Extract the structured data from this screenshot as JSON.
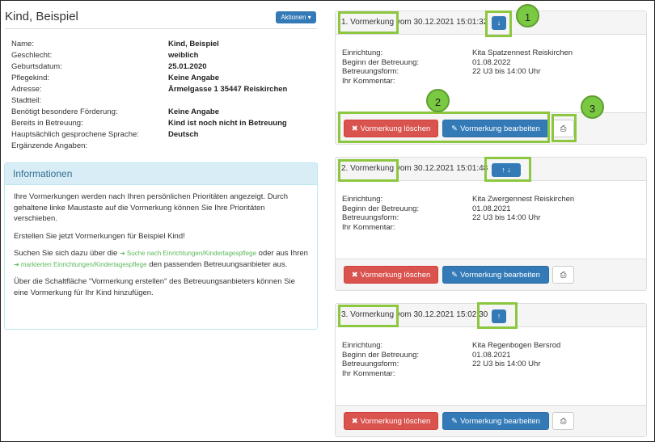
{
  "person": {
    "name": "Kind, Beispiel",
    "actions_label": "Aktionen ▾"
  },
  "details": [
    {
      "label": "Name:",
      "value": "Kind, Beispiel"
    },
    {
      "label": "Geschlecht:",
      "value": "weiblich"
    },
    {
      "label": "Geburtsdatum:",
      "value": "25.01.2020"
    },
    {
      "label": "Pflegekind:",
      "value": "Keine Angabe"
    },
    {
      "label": "Adresse:",
      "value": "Ärmelgasse 1 35447 Reiskirchen"
    },
    {
      "label": "Stadtteil:",
      "value": ""
    },
    {
      "label": "Benötigt besondere Förderung:",
      "value": "Keine Angabe"
    },
    {
      "label": "Bereits in Betreuung:",
      "value": "Kind ist noch nicht in Betreuung"
    },
    {
      "label": "Hauptsächlich gesprochene Sprache:",
      "value": "Deutsch"
    },
    {
      "label": "Ergänzende Angaben:",
      "value": ""
    }
  ],
  "info_panel": {
    "title": "Informationen",
    "p1": "Ihre Vormerkungen werden nach Ihren persönlichen Prioritäten angezeigt. Durch gehaltene linke Maustaste auf die Vormerkung können Sie Ihre Prioritäten verschieben.",
    "p2": "Erstellen Sie jetzt Vormerkungen für Beispiel Kind!",
    "p3_a": "Suchen Sie sich dazu über die",
    "p3_link1": "➜ Suche nach Einrichtungen/Kindertagespflege",
    "p3_b": "oder aus Ihren",
    "p3_link2": "➜ markierten Einrichtungen/Kindertagespflege",
    "p3_c": "den passenden Betreuungsanbieter aus.",
    "p4": "Über die Schaltfläche \"Vormerkung erstellen\" des Betreuungsanbieters können Sie eine Vormerkung für Ihr Kind hinzufügen."
  },
  "labels": {
    "einrichtung": "Einrichtung:",
    "beginn": "Beginn der Betreuung:",
    "form": "Betreuungsform:",
    "kommentar": "Ihr Kommentar:",
    "delete": "Vormerkung löschen",
    "edit": "Vormerkung bearbeiten"
  },
  "reservations": [
    {
      "title": "1. Vormerkung vom 30.12.2021 15:01:32",
      "einrichtung": "Kita Spatzennest Reiskirchen",
      "beginn": "01.08.2022",
      "form": "22 U3 bis 14:00 Uhr",
      "arrows": "↓"
    },
    {
      "title": "2. Vormerkung vom 30.12.2021 15:01:48",
      "einrichtung": "Kita Zwergennest Reiskirchen",
      "beginn": "01.08.2021",
      "form": "22 U3 bis 14:00 Uhr",
      "arrows": "↑ ↓"
    },
    {
      "title": "3. Vormerkung vom 30.12.2021 15:02:30",
      "einrichtung": "Kita Regenbogen Bersrod",
      "beginn": "01.08.2021",
      "form": "22 U3 bis 14:00 Uhr",
      "arrows": "↑"
    }
  ],
  "callouts": [
    "1",
    "2",
    "3"
  ],
  "colors": {
    "primary": "#337ab7",
    "danger": "#d9534f",
    "highlight": "#8dc63f",
    "info_bg": "#d9edf7"
  }
}
